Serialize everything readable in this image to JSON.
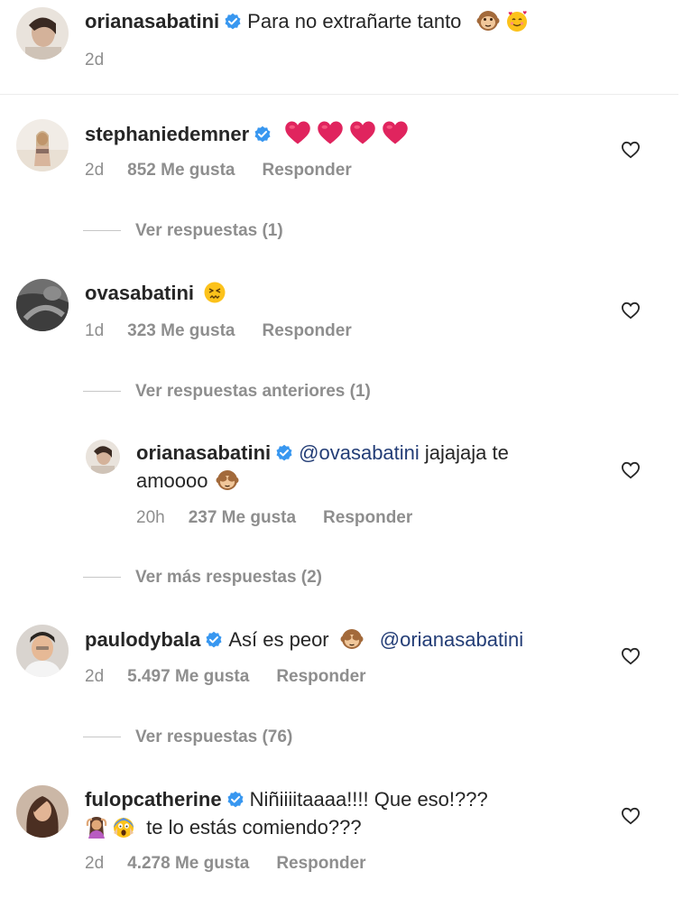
{
  "caption": {
    "username": "orianasabatini",
    "text": "Para no extrañarte tanto",
    "time": "2d",
    "emojis": [
      "monkey-face-emoji",
      "smiling-face-with-hearts-emoji"
    ]
  },
  "comments": [
    {
      "username": "stephaniedemner",
      "verified": true,
      "text": "",
      "emojis": [
        "red-heart-emoji",
        "red-heart-emoji",
        "red-heart-emoji",
        "red-heart-emoji"
      ],
      "time": "2d",
      "likes": "852 Me gusta",
      "reply": "Responder",
      "view_replies": "Ver respuestas (1)"
    },
    {
      "username": "ovasabatini",
      "verified": false,
      "text": "",
      "emojis": [
        "persevering-face-emoji"
      ],
      "time": "1d",
      "likes": "323 Me gusta",
      "reply": "Responder",
      "view_replies": "Ver respuestas anteriores (1)"
    },
    {
      "username": "orianasabatini",
      "verified": true,
      "mention": "@ovasabatini",
      "text_line1": "jajajaja te",
      "text_line2": "amoooo",
      "emojis": [
        "see-no-evil-monkey-emoji"
      ],
      "time": "20h",
      "likes": "237 Me gusta",
      "reply": "Responder",
      "view_replies": "Ver más respuestas (2)"
    },
    {
      "username": "paulodybala",
      "verified": true,
      "text": "Así es peor",
      "emojis": [
        "see-no-evil-monkey-emoji"
      ],
      "mention": "@orianasabatini",
      "time": "2d",
      "likes": "5.497 Me gusta",
      "reply": "Responder",
      "view_replies": "Ver respuestas (76)"
    },
    {
      "username": "fulopcatherine",
      "verified": true,
      "text_line1": "Niñiiiitaaaa!!!! Que eso!???",
      "text_line2": "te lo estás comiendo???",
      "emojis": [
        "woman-gesturing-ok-emoji",
        "face-screaming-in-fear-emoji"
      ],
      "time": "2d",
      "likes": "4.278 Me gusta",
      "reply": "Responder"
    }
  ],
  "colors": {
    "text": "#262626",
    "secondary": "#8e8e8e",
    "mention": "#233d76",
    "verified": "#3897f0",
    "heart": "#e0245e"
  }
}
